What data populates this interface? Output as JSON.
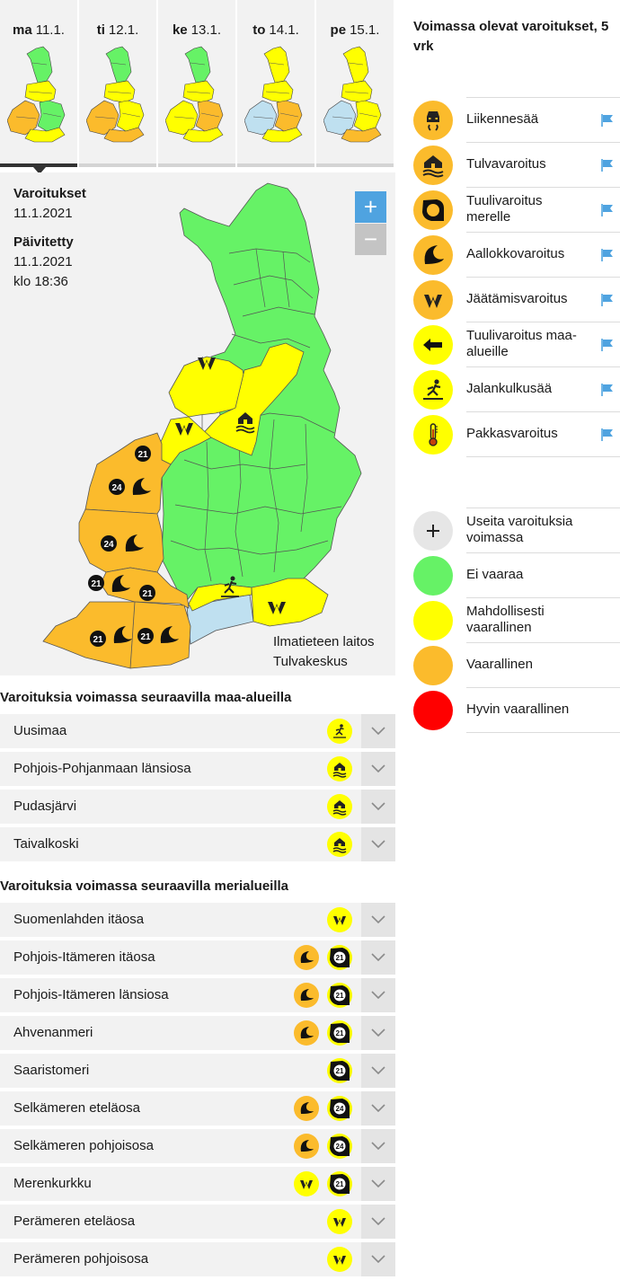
{
  "days": [
    {
      "dow": "ma",
      "date": "11.1.",
      "active": true
    },
    {
      "dow": "ti",
      "date": "12.1.",
      "active": false
    },
    {
      "dow": "ke",
      "date": "13.1.",
      "active": false
    },
    {
      "dow": "to",
      "date": "14.1.",
      "active": false
    },
    {
      "dow": "pe",
      "date": "15.1.",
      "active": false
    }
  ],
  "info": {
    "warnings_heading": "Varoitukset",
    "warnings_date": "11.1.2021",
    "updated_heading": "Päivitetty",
    "updated_date": "11.1.2021",
    "updated_time": "klo 18:36"
  },
  "zoom": {
    "in": "+",
    "out": "−"
  },
  "credit": {
    "line1": "Ilmatieteen laitos",
    "line2": "Tulvakeskus"
  },
  "land_section": {
    "title": "Varoituksia voimassa seuraavilla maa-alueilla",
    "rows": [
      {
        "name": "Uusimaa",
        "icons": [
          {
            "type": "pedestrian",
            "level": "y"
          }
        ]
      },
      {
        "name": "Pohjois-Pohjanmaan länsiosa",
        "icons": [
          {
            "type": "flood",
            "level": "y"
          }
        ]
      },
      {
        "name": "Pudasjärvi",
        "icons": [
          {
            "type": "flood",
            "level": "y"
          }
        ]
      },
      {
        "name": "Taivalkoski",
        "icons": [
          {
            "type": "flood",
            "level": "y"
          }
        ]
      }
    ]
  },
  "sea_section": {
    "title": "Varoituksia voimassa seuraavilla merialueilla",
    "rows": [
      {
        "name": "Suomenlahden itäosa",
        "icons": [
          {
            "type": "ice",
            "level": "y"
          }
        ]
      },
      {
        "name": "Pohjois-Itämeren itäosa",
        "icons": [
          {
            "type": "wave",
            "level": "o"
          },
          {
            "type": "wind",
            "level": "y",
            "num": "21"
          }
        ]
      },
      {
        "name": "Pohjois-Itämeren länsiosa",
        "icons": [
          {
            "type": "wave",
            "level": "o"
          },
          {
            "type": "wind",
            "level": "y",
            "num": "21"
          }
        ]
      },
      {
        "name": "Ahvenanmeri",
        "icons": [
          {
            "type": "wave",
            "level": "o"
          },
          {
            "type": "wind",
            "level": "y",
            "num": "21"
          }
        ]
      },
      {
        "name": "Saaristomeri",
        "icons": [
          {
            "type": "wind",
            "level": "y",
            "num": "21"
          }
        ]
      },
      {
        "name": "Selkämeren eteläosa",
        "icons": [
          {
            "type": "wave",
            "level": "o"
          },
          {
            "type": "wind",
            "level": "y",
            "num": "24"
          }
        ]
      },
      {
        "name": "Selkämeren pohjoisosa",
        "icons": [
          {
            "type": "wave",
            "level": "o"
          },
          {
            "type": "wind",
            "level": "y",
            "num": "24"
          }
        ]
      },
      {
        "name": "Merenkurkku",
        "icons": [
          {
            "type": "ice",
            "level": "y"
          },
          {
            "type": "wind",
            "level": "y",
            "num": "21"
          }
        ]
      },
      {
        "name": "Perämeren eteläosa",
        "icons": [
          {
            "type": "ice",
            "level": "y"
          }
        ]
      },
      {
        "name": "Perämeren pohjoisosa",
        "icons": [
          {
            "type": "ice",
            "level": "y"
          }
        ]
      }
    ]
  },
  "legend": {
    "title": "Voimassa olevat varoitukset, 5 vrk",
    "warning_types": [
      {
        "label": "Liikennesää",
        "icon": "traffic-icon",
        "color": "#fbbb2c"
      },
      {
        "label": "Tulvavaroitus",
        "icon": "flood-icon",
        "color": "#fbbb2c"
      },
      {
        "label": "Tuulivaroitus merelle",
        "icon": "sea-wind-icon",
        "color": "#fbbb2c"
      },
      {
        "label": "Aallokkovaroitus",
        "icon": "wave-icon",
        "color": "#fbbb2c"
      },
      {
        "label": "Jäätämisvaroitus",
        "icon": "ice-icon",
        "color": "#fbbb2c"
      },
      {
        "label": "Tuulivaroitus maa-alueille",
        "icon": "land-wind-icon",
        "color": "#ffff00"
      },
      {
        "label": "Jalankulkusää",
        "icon": "pedestrian-icon",
        "color": "#ffff00"
      },
      {
        "label": "Pakkasvaroitus",
        "icon": "thermometer-icon",
        "color": "#ffff00"
      }
    ],
    "levels": [
      {
        "label": "Useita varoituksia voimassa",
        "color": "#e6e6e6",
        "icon": "plus-icon"
      },
      {
        "label": "Ei vaaraa",
        "color": "#66f266"
      },
      {
        "label": "Mahdollisesti vaarallinen",
        "color": "#ffff00"
      },
      {
        "label": "Vaarallinen",
        "color": "#fbbb2c"
      },
      {
        "label": "Hyvin vaarallinen",
        "color": "#ff0000"
      }
    ]
  },
  "colors": {
    "green": "#66f266",
    "yellow": "#ffff00",
    "orange": "#fbbb2c",
    "blue": "#bfe0f0",
    "flag": "#4fa3e0"
  }
}
